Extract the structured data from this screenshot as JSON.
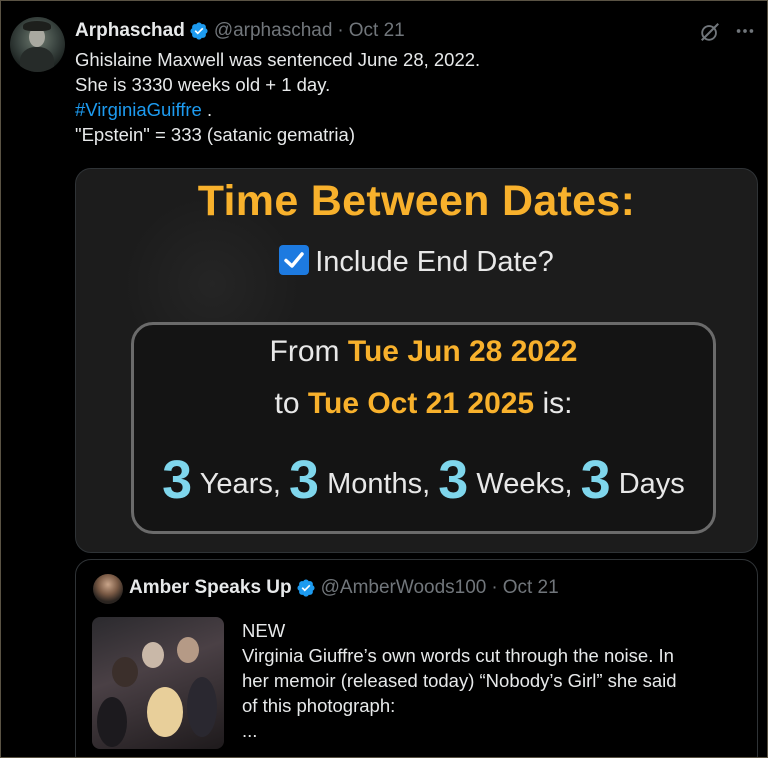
{
  "tweet": {
    "display_name": "Arphaschad",
    "handle": "@arphaschad",
    "separator": "·",
    "time": "Oct 21",
    "lines": [
      "Ghislaine Maxwell was sentenced June 28, 2022.",
      "She is 3330 weeks old + 1 day."
    ],
    "hashtag": "#VirginiaGuiffre",
    "hashtag_suffix": " .",
    "last_line": " \"Epstein\" = 333 (satanic gematria)",
    "icons": [
      "verified-badge-icon",
      "grok-icon",
      "more-icon"
    ]
  },
  "media": {
    "title": "Time Between Dates:",
    "checkbox_label": "Include End Date?",
    "checkbox_checked": true,
    "from_prefix": "From ",
    "from_date": "Tue Jun 28 2022",
    "to_prefix": "to ",
    "to_date": "Tue Oct 21 2025",
    "to_suffix": " is:",
    "years_value": "3",
    "years_label": " Years, ",
    "months_value": "3",
    "months_label": " Months, ",
    "weeks_value": "3",
    "weeks_label": " Weeks, ",
    "days_value": "3",
    "days_label": " Days",
    "colors": {
      "accent": "#f8b12c",
      "number": "#7fd6ec",
      "checkbox": "#1d7ae0"
    }
  },
  "quote": {
    "display_name": "Amber Speaks Up",
    "handle": "@AmberWoods100",
    "separator": "·",
    "time": "Oct 21",
    "lines": [
      "NEW",
      "Virginia Giuffre’s own words cut through the noise. In",
      "her memoir (released today) “Nobody’s Girl” she said",
      "of this photograph:",
      "..."
    ]
  },
  "colors": {
    "link": "#1d9bf0",
    "muted": "#71767b",
    "verified": "#1d9bf0"
  }
}
